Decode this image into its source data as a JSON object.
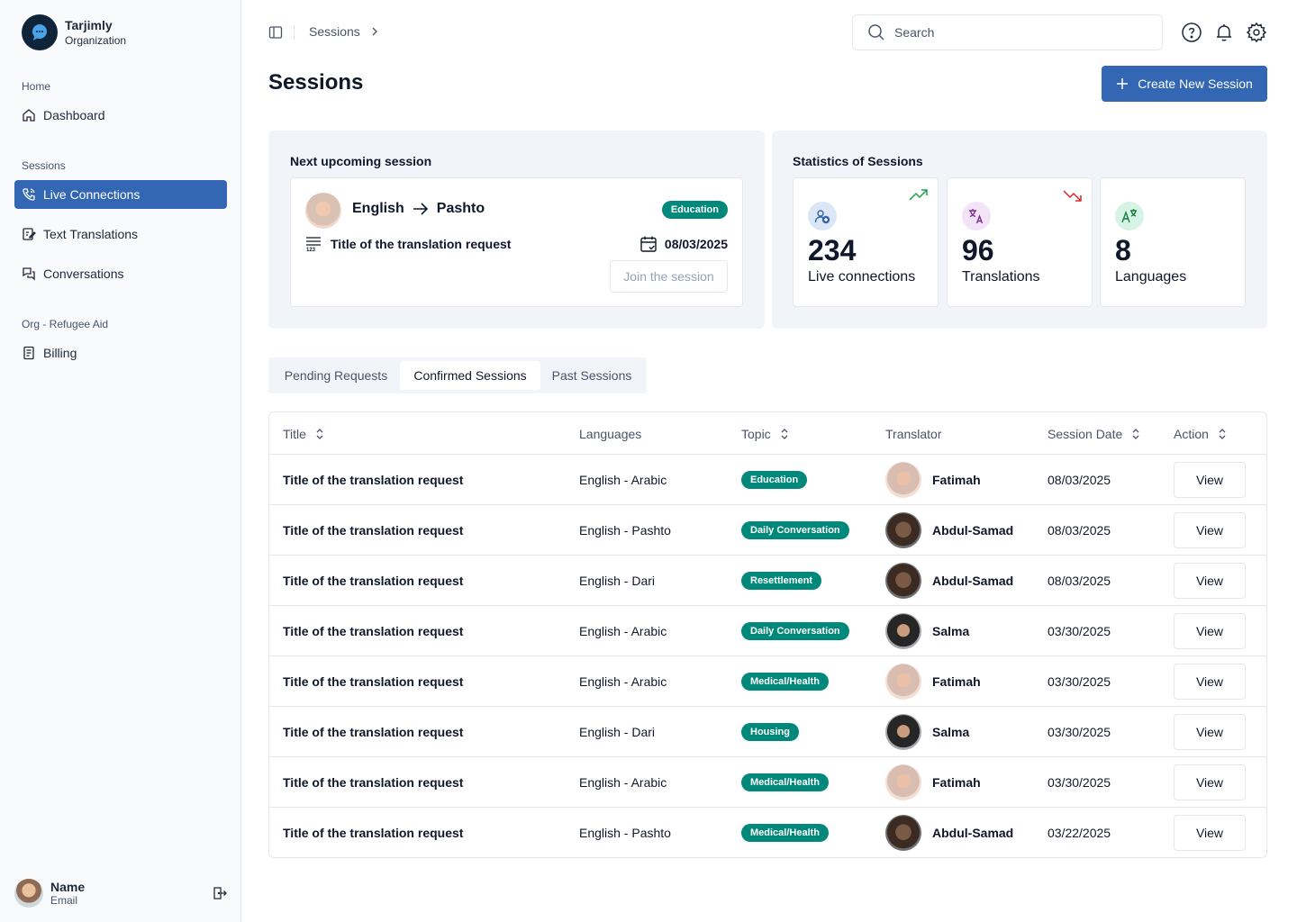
{
  "brand": {
    "name": "Tarjimly",
    "subtitle": "Organization"
  },
  "sidebar": {
    "groups": [
      {
        "label": "Home",
        "items": [
          {
            "label": "Dashboard",
            "icon": "home-icon"
          }
        ]
      },
      {
        "label": "Sessions",
        "items": [
          {
            "label": "Live Connections",
            "icon": "phone-icon",
            "active": true
          },
          {
            "label": "Text Translations",
            "icon": "edit-document-icon"
          },
          {
            "label": "Conversations",
            "icon": "chat-icon"
          }
        ]
      },
      {
        "label": "Org - Refugee Aid",
        "items": [
          {
            "label": "Billing",
            "icon": "receipt-icon"
          }
        ]
      }
    ],
    "user": {
      "name": "Name",
      "email": "Email"
    }
  },
  "topbar": {
    "breadcrumb": "Sessions",
    "search_placeholder": "Search"
  },
  "page": {
    "title": "Sessions",
    "create_button": "Create New Session"
  },
  "upcoming": {
    "heading": "Next upcoming session",
    "from_lang": "English",
    "to_lang": "Pashto",
    "topic": "Education",
    "title": "Title of the translation request",
    "date": "08/03/2025",
    "join_label": "Join the session"
  },
  "stats": {
    "heading": "Statistics of Sessions",
    "cards": [
      {
        "value": "234",
        "label": "Live connections",
        "trend": "up",
        "color": "#dbe7f6"
      },
      {
        "value": "96",
        "label": "Translations",
        "trend": "down",
        "color": "#f3e3f7"
      },
      {
        "value": "8",
        "label": "Languages",
        "trend": "none",
        "color": "#d7f3e6"
      }
    ]
  },
  "tabs": [
    {
      "label": "Pending Requests",
      "active": false
    },
    {
      "label": "Confirmed Sessions",
      "active": true
    },
    {
      "label": "Past Sessions",
      "active": false
    }
  ],
  "table": {
    "columns": [
      "Title",
      "Languages",
      "Topic",
      "Translator",
      "Session Date",
      "Action"
    ],
    "rows": [
      {
        "title": "Title of the translation request",
        "languages": "English - Arabic",
        "topic": "Education",
        "translator": "Fatimah",
        "date": "08/03/2025",
        "action": "View"
      },
      {
        "title": "Title of the translation request",
        "languages": "English - Pashto",
        "topic": "Daily Conversation",
        "translator": "Abdul-Samad",
        "date": "08/03/2025",
        "action": "View"
      },
      {
        "title": "Title of the translation request",
        "languages": "English - Dari",
        "topic": "Resettlement",
        "translator": "Abdul-Samad",
        "date": "08/03/2025",
        "action": "View"
      },
      {
        "title": "Title of the translation request",
        "languages": "English - Arabic",
        "topic": "Daily Conversation",
        "translator": "Salma",
        "date": "03/30/2025",
        "action": "View"
      },
      {
        "title": "Title of the translation request",
        "languages": "English - Arabic",
        "topic": "Medical/Health",
        "translator": "Fatimah",
        "date": "03/30/2025",
        "action": "View"
      },
      {
        "title": "Title of the translation request",
        "languages": "English - Dari",
        "topic": "Housing",
        "translator": "Salma",
        "date": "03/30/2025",
        "action": "View"
      },
      {
        "title": "Title of the translation request",
        "languages": "English - Arabic",
        "topic": "Medical/Health",
        "translator": "Fatimah",
        "date": "03/30/2025",
        "action": "View"
      },
      {
        "title": "Title of the translation request",
        "languages": "English - Pashto",
        "topic": "Medical/Health",
        "translator": "Abdul-Samad",
        "date": "03/22/2025",
        "action": "View"
      }
    ]
  },
  "colors": {
    "primary": "#3366b3",
    "badge": "#00897b",
    "trend_up": "#16a34a",
    "trend_down": "#dc2626"
  }
}
